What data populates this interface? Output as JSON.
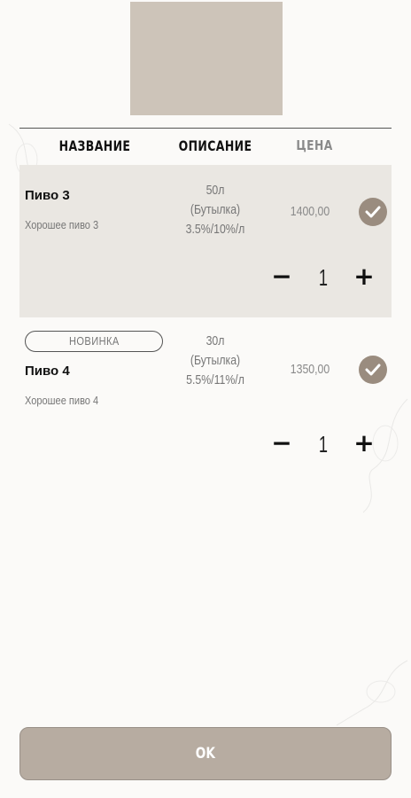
{
  "table": {
    "headers": {
      "name": "НАЗВАНИЕ",
      "description": "ОПИСАНИЕ",
      "price": "ЦЕНА"
    }
  },
  "items": [
    {
      "name": "Пиво 3",
      "subtitle": "Хорошее пиво 3",
      "desc_line1": "50л",
      "desc_line2": "(Бутылка)",
      "desc_line3": "3.5%/10%/л",
      "price": "1400,00",
      "quantity": "1",
      "selected": true,
      "badge": ""
    },
    {
      "name": "Пиво 4",
      "subtitle": "Хорошее пиво 4",
      "desc_line1": "30л",
      "desc_line2": "(Бутылка)",
      "desc_line3": "5.5%/11%/л",
      "price": "1350,00",
      "quantity": "1",
      "selected": false,
      "badge": "НОВИНКА"
    }
  ],
  "controls": {
    "minus": "−",
    "plus": "+",
    "ok_label": "OK"
  },
  "colors": {
    "accent": "#9a8c7f",
    "row_selected_bg": "#eae7e2",
    "button_bg": "#b7aca1",
    "image_placeholder": "#cdc4b9"
  },
  "icons": {
    "check": "check-circle-icon"
  }
}
